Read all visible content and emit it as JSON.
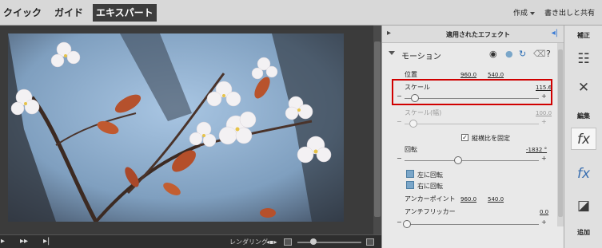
{
  "topbar": {
    "tabs": [
      "クイック",
      "ガイド",
      "エキスパート"
    ],
    "create_label": "作成",
    "share_label": "書き出しと共有"
  },
  "bottombar": {
    "render_label": "レンダリング"
  },
  "panel": {
    "title": "適用されたエフェクト",
    "effect_name": "モーション",
    "position": {
      "label": "位置",
      "x": "960.0",
      "y": "540.0"
    },
    "scale": {
      "label": "スケール",
      "value": "115.6",
      "level": 0.06
    },
    "scale_width": {
      "label": "スケール(幅)",
      "value": "100.0",
      "level": 0.05
    },
    "keep_ratio_label": "縦横比を固定",
    "keep_ratio_checked": true,
    "rotation": {
      "label": "回転",
      "value": "-1832 °",
      "level": 0.38
    },
    "rotate_left_label": "左に回転",
    "rotate_right_label": "右に回転",
    "anchor": {
      "label": "アンカーポイント",
      "x": "960.0",
      "y": "540.0"
    },
    "antiflicker": {
      "label": "アンチフリッカー",
      "value": "0.0",
      "level": 0.0
    }
  },
  "right_toolbar": {
    "adjust_label": "補正",
    "edit_label": "編集",
    "add_label": "追加"
  }
}
